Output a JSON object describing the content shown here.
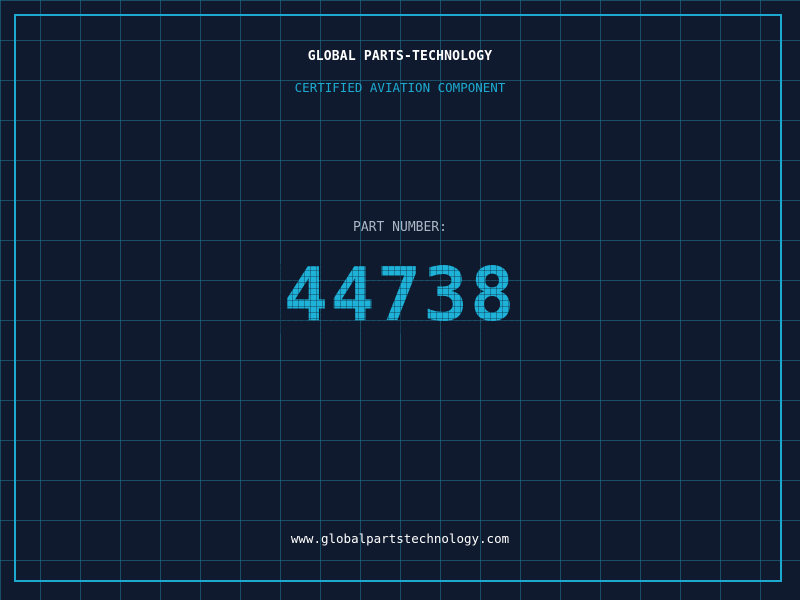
{
  "header": {
    "company_name": "GLOBAL PARTS-TECHNOLOGY",
    "subtitle": "CERTIFIED AVIATION COMPONENT"
  },
  "part": {
    "label": "PART NUMBER:",
    "number": "44738"
  },
  "footer": {
    "website": "www.globalpartstechnology.com"
  },
  "colors": {
    "background": "#0f1a2e",
    "grid": "#227896",
    "accent": "#1eaad0",
    "title_text": "#ffffff",
    "label_text": "#a9b8c6"
  }
}
